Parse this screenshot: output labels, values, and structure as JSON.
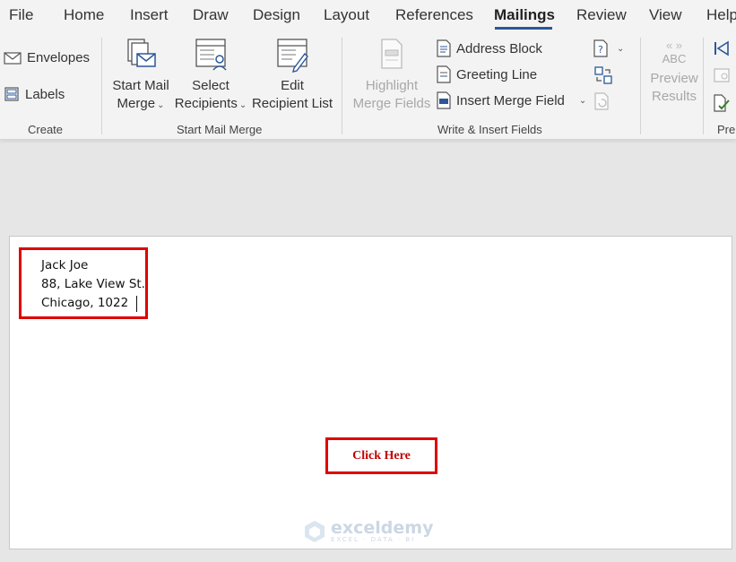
{
  "menu": {
    "tabs": [
      "File",
      "Home",
      "Insert",
      "Draw",
      "Design",
      "Layout",
      "References",
      "Mailings",
      "Review",
      "View",
      "Help"
    ],
    "active": "Mailings"
  },
  "ribbon": {
    "create": {
      "envelopes": "Envelopes",
      "labels": "Labels",
      "group_label": "Create"
    },
    "start_mail_merge": {
      "start_line1": "Start Mail",
      "start_line2": "Merge",
      "select_line1": "Select",
      "select_line2": "Recipients",
      "edit_line1": "Edit",
      "edit_line2": "Recipient List",
      "group_label": "Start Mail Merge"
    },
    "write_insert": {
      "highlight_line1": "Highlight",
      "highlight_line2": "Merge Fields",
      "address_block": "Address Block",
      "greeting_line": "Greeting Line",
      "insert_merge_field": "Insert Merge Field",
      "group_label": "Write & Insert Fields"
    },
    "preview": {
      "abc": "ABC",
      "preview_line1": "Preview",
      "preview_line2": "Results",
      "group_label_partial": "Pre"
    }
  },
  "document": {
    "address": [
      "Jack Joe",
      "88, Lake View St.",
      "Chicago, 1022"
    ],
    "button_label": "Click Here",
    "watermark": "exceldemy",
    "watermark_sub": "EXCEL · DATA · BI"
  },
  "colors": {
    "accent": "#2b579a",
    "highlight_border": "#e00000",
    "button_text": "#c00000"
  }
}
